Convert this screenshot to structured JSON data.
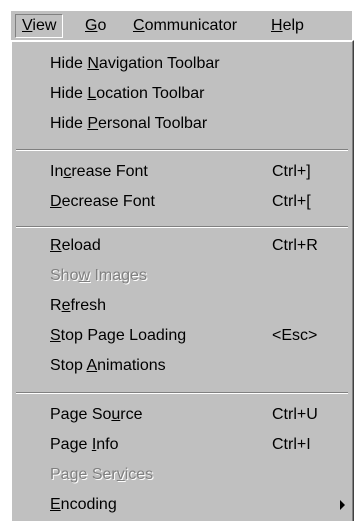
{
  "menubar": {
    "items": [
      {
        "pre": "",
        "ul": "V",
        "post": "iew"
      },
      {
        "pre": "",
        "ul": "G",
        "post": "o"
      },
      {
        "pre": "",
        "ul": "C",
        "post": "ommunicator"
      },
      {
        "pre": "",
        "ul": "H",
        "post": "elp"
      }
    ]
  },
  "menu": {
    "hide_navigation": {
      "pre": "Hide ",
      "ul": "N",
      "post": "avigation Toolbar"
    },
    "hide_location": {
      "pre": "Hide ",
      "ul": "L",
      "post": "ocation Toolbar"
    },
    "hide_personal": {
      "pre": "Hide ",
      "ul": "P",
      "post": "ersonal Toolbar"
    },
    "increase_font": {
      "pre": "In",
      "ul": "c",
      "post": "rease Font",
      "shortcut": "Ctrl+]"
    },
    "decrease_font": {
      "pre": "",
      "ul": "D",
      "post": "ecrease Font",
      "shortcut": "Ctrl+["
    },
    "reload": {
      "pre": "",
      "ul": "R",
      "post": "eload",
      "shortcut": "Ctrl+R"
    },
    "show_images": {
      "pre": "Sho",
      "ul": "w",
      "post": " Images"
    },
    "refresh": {
      "pre": "R",
      "ul": "e",
      "post": "fresh"
    },
    "stop_loading": {
      "pre": "",
      "ul": "S",
      "post": "top Page Loading",
      "shortcut": "<Esc>"
    },
    "stop_animations": {
      "pre": "Stop ",
      "ul": "A",
      "post": "nimations"
    },
    "page_source": {
      "pre": "Page So",
      "ul": "u",
      "post": "rce",
      "shortcut": "Ctrl+U"
    },
    "page_info": {
      "pre": "Page ",
      "ul": "I",
      "post": "nfo",
      "shortcut": "Ctrl+I"
    },
    "page_services": {
      "pre": "Page Ser",
      "ul": "v",
      "post": "ices"
    },
    "encoding": {
      "pre": "",
      "ul": "E",
      "post": "ncoding"
    }
  },
  "icons": {
    "submenu": "submenu-arrow-icon"
  },
  "colors": {
    "menu_bg": "#c0c0c0",
    "disabled_text": "#808080"
  }
}
